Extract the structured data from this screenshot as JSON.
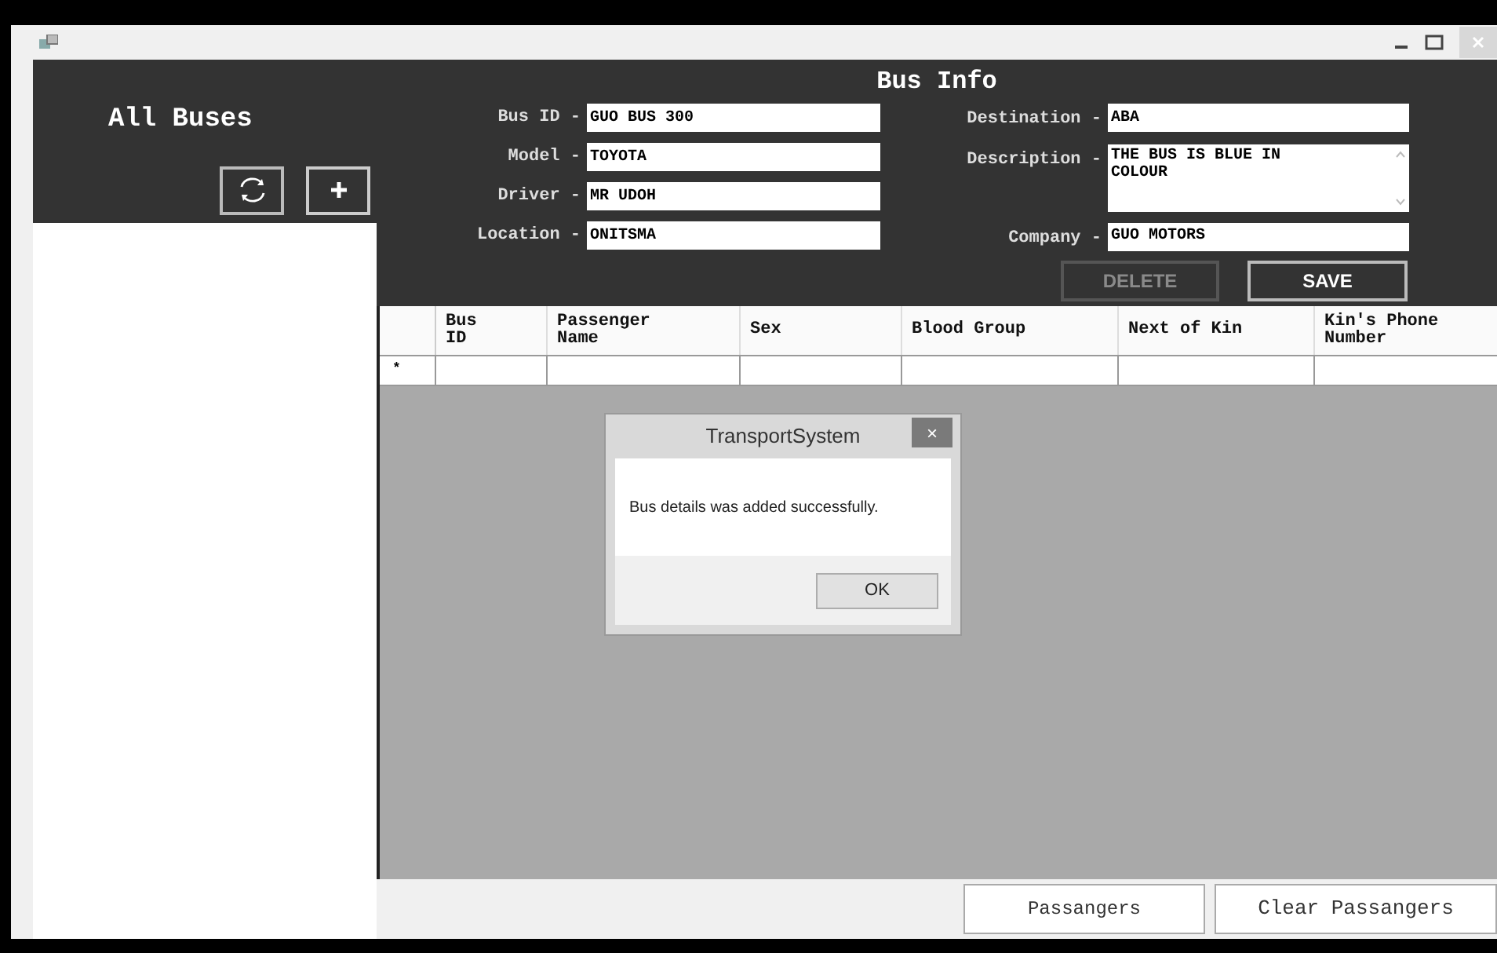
{
  "sidebar": {
    "title": "All Buses"
  },
  "form": {
    "title": "Bus Info",
    "left_fields": [
      {
        "label": "Bus ID -",
        "value": "GUO BUS 300"
      },
      {
        "label": "Model -",
        "value": "TOYOTA"
      },
      {
        "label": "Driver -",
        "value": "MR UDOH"
      },
      {
        "label": "Location -",
        "value": "ONITSMA"
      }
    ],
    "right_fields": [
      {
        "label": "Destination -",
        "value": "ABA",
        "kind": "line"
      },
      {
        "label": "Description -",
        "value": "THE BUS IS BLUE IN COLOUR",
        "kind": "multiline"
      },
      {
        "label": "Company -",
        "value": "GUO MOTORS",
        "kind": "line"
      }
    ],
    "buttons": [
      {
        "label": "DELETE",
        "disabled": true
      },
      {
        "label": "SAVE",
        "disabled": false
      }
    ]
  },
  "table": {
    "columns": [
      "Bus\nID",
      "Passenger\nName",
      "Sex",
      "Blood Group",
      "Next of Kin",
      "Kin's Phone\nNumber"
    ],
    "new_row_marker": "*"
  },
  "bottom_buttons": [
    "Passangers",
    "Clear Passangers"
  ],
  "dialog": {
    "title": "TransportSystem",
    "close": "×",
    "message": "Bus details was added successfully.",
    "button": "OK"
  }
}
